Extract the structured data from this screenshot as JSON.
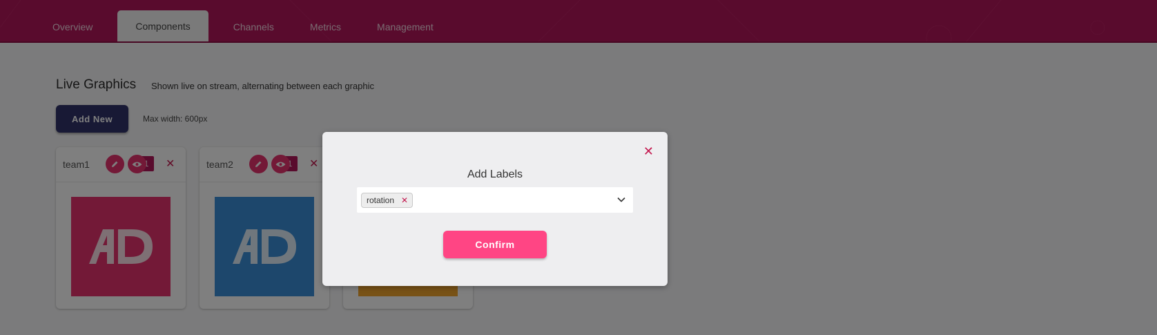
{
  "nav": {
    "tabs": [
      {
        "label": "Overview",
        "active": false
      },
      {
        "label": "Components",
        "active": true
      },
      {
        "label": "Channels",
        "active": false
      },
      {
        "label": "Metrics",
        "active": false
      },
      {
        "label": "Management",
        "active": false
      }
    ]
  },
  "main": {
    "title": "Live Graphics",
    "subtitle": "Shown live on stream, alternating between each graphic",
    "add_new_label": "Add New",
    "max_width_text": "Max width: 600px",
    "cards": [
      {
        "name": "team1",
        "count": "1",
        "color": "#e6326e",
        "logo_text": "AD"
      },
      {
        "name": "team2",
        "count": "1",
        "color": "#3a8fd9",
        "logo_text": "AD"
      },
      {
        "name": "",
        "count": "",
        "color": "#f0a52c",
        "logo_text": ""
      }
    ]
  },
  "modal": {
    "title": "Add Labels",
    "close_icon": "close-icon",
    "selected_labels": [
      "rotation"
    ],
    "confirm_label": "Confirm"
  },
  "colors": {
    "brand": "#b3175a",
    "accent": "#ff4584",
    "primary_button": "#30336b"
  }
}
